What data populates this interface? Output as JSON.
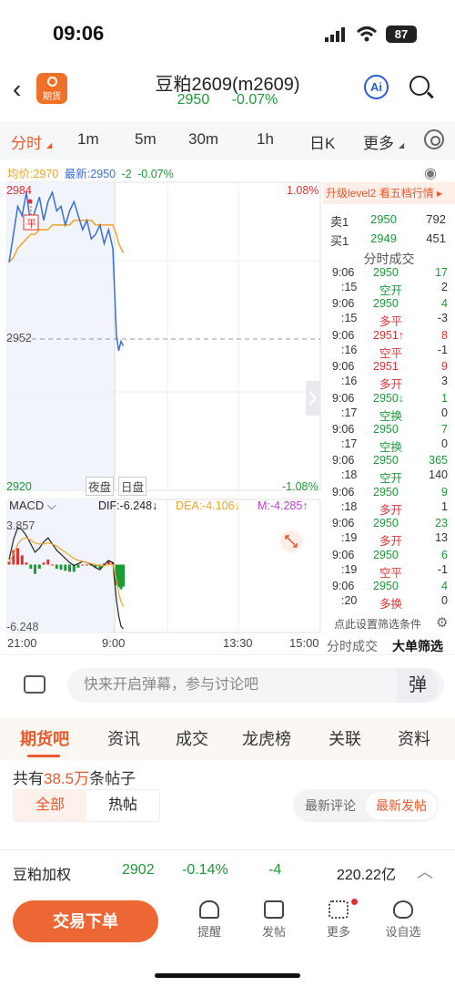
{
  "status": {
    "time": "09:06",
    "battery": "87"
  },
  "nav": {
    "app_badge": "期货",
    "title": "豆粕2609(m2609)",
    "price": "2950",
    "change_pct": "-0.07%",
    "ai_label": "Ai"
  },
  "tabs": {
    "items": [
      "分时",
      "1m",
      "5m",
      "30m",
      "1h",
      "日K",
      "更多"
    ]
  },
  "info": {
    "avg_label": "均价:2970",
    "latest_label": "最新:2950",
    "change": "-2",
    "change_pct": "-0.07%"
  },
  "chart": {
    "price_high": "2984",
    "price_mid": "2952",
    "price_low": "2920",
    "pct_high": "1.08%",
    "pct_low": "-1.08%",
    "night_label": "夜盘",
    "day_label": "日盘",
    "marker": "平",
    "macd_label": "MACD",
    "dif": "DIF:-6.248↓",
    "dea": "DEA:-4.106↓",
    "m": "M:-4.285↑",
    "macd_high": "3.857",
    "macd_low": "-6.248",
    "time_labels": [
      "21:00",
      "9:00",
      "13:30",
      "15:00"
    ]
  },
  "chart_data": {
    "type": "line",
    "title": "",
    "x": [
      "21:00",
      "21:05",
      "21:10",
      "21:15",
      "21:20",
      "21:25",
      "21:30",
      "21:35",
      "21:40",
      "21:45",
      "21:50",
      "21:55",
      "22:00",
      "22:05",
      "22:10",
      "22:15",
      "22:20",
      "22:25",
      "22:30",
      "22:35",
      "22:40",
      "22:45",
      "22:50",
      "22:55",
      "23:00",
      "9:00",
      "9:02",
      "9:04",
      "9:06"
    ],
    "series": [
      {
        "name": "最新",
        "values": [
          2968,
          2974,
          2980,
          2978,
          2983,
          2976,
          2979,
          2982,
          2977,
          2981,
          2983,
          2979,
          2980,
          2976,
          2979,
          2981,
          2978,
          2975,
          2977,
          2973,
          2974,
          2976,
          2972,
          2975,
          2971,
          2952,
          2949,
          2951,
          2950
        ]
      },
      {
        "name": "均价",
        "values": [
          2968,
          2969,
          2971,
          2972,
          2973,
          2974,
          2974,
          2975,
          2975,
          2975,
          2976,
          2976,
          2976,
          2976,
          2976,
          2977,
          2977,
          2977,
          2977,
          2977,
          2976,
          2976,
          2976,
          2976,
          2976,
          2974,
          2972,
          2971,
          2970
        ]
      }
    ],
    "ylim": [
      2920,
      2984
    ],
    "reference": 2952,
    "macd_ylim": [
      -6.248,
      3.857
    ]
  },
  "side": {
    "upgrade": "升级level2 看五档行情 ▸",
    "ask_label": "卖1",
    "ask_price": "2950",
    "ask_vol": "792",
    "bid_label": "买1",
    "bid_price": "2949",
    "bid_vol": "451",
    "trades_title": "分时成交",
    "trades": [
      {
        "t1": "9:06",
        "t2": ":15",
        "price": "2950",
        "vol": "17",
        "type": "空开",
        "delta": "2"
      },
      {
        "t1": "9:06",
        "t2": ":15",
        "price": "2950",
        "vol": "4",
        "type": "多平",
        "delta": "-3"
      },
      {
        "t1": "9:06",
        "t2": ":16",
        "price": "2951↑",
        "vol": "8",
        "type": "空平",
        "delta": "-1"
      },
      {
        "t1": "9:06",
        "t2": ":16",
        "price": "2951",
        "vol": "9",
        "type": "多开",
        "delta": "3"
      },
      {
        "t1": "9:06",
        "t2": ":17",
        "price": "2950↓",
        "vol": "1",
        "type": "空换",
        "delta": "0"
      },
      {
        "t1": "9:06",
        "t2": ":17",
        "price": "2950",
        "vol": "7",
        "type": "空换",
        "delta": "0"
      },
      {
        "t1": "9:06",
        "t2": ":18",
        "price": "2950",
        "vol": "365",
        "type": "空开",
        "delta": "140"
      },
      {
        "t1": "9:06",
        "t2": ":18",
        "price": "2950",
        "vol": "9",
        "type": "多开",
        "delta": "1"
      },
      {
        "t1": "9:06",
        "t2": ":19",
        "price": "2950",
        "vol": "23",
        "type": "多开",
        "delta": "13"
      },
      {
        "t1": "9:06",
        "t2": ":19",
        "price": "2950",
        "vol": "6",
        "type": "空平",
        "delta": "-1"
      },
      {
        "t1": "9:06",
        "t2": ":20",
        "price": "2950",
        "vol": "4",
        "type": "多换",
        "delta": "0"
      }
    ],
    "filter_hint": "点此设置筛选条件",
    "tab_trades": "分时成交",
    "tab_big": "大单筛选"
  },
  "comment": {
    "placeholder": "快来开启弹幕，参与讨论吧",
    "danmu": "弹"
  },
  "content_tabs": [
    "期货吧",
    "资讯",
    "成交",
    "龙虎榜",
    "关联",
    "资料"
  ],
  "posts": {
    "prefix": "共有",
    "count": "38.5万",
    "suffix": "条帖子",
    "all": "全部",
    "hot": "热帖",
    "latest_comment": "最新评论",
    "latest_post": "最新发帖"
  },
  "ticker": {
    "name": "豆粕加权",
    "price": "2902",
    "pct": "-0.14%",
    "change": "-4",
    "amount": "220.22亿"
  },
  "bottom": {
    "trade": "交易下单",
    "items": [
      "提醒",
      "发帖",
      "更多",
      "设自选"
    ]
  },
  "colors": {
    "accent": "#e85a2c",
    "up": "#e03131",
    "down": "#1a9b36",
    "price_line": "#3b6fd1",
    "avg_line": "#f0a428"
  }
}
